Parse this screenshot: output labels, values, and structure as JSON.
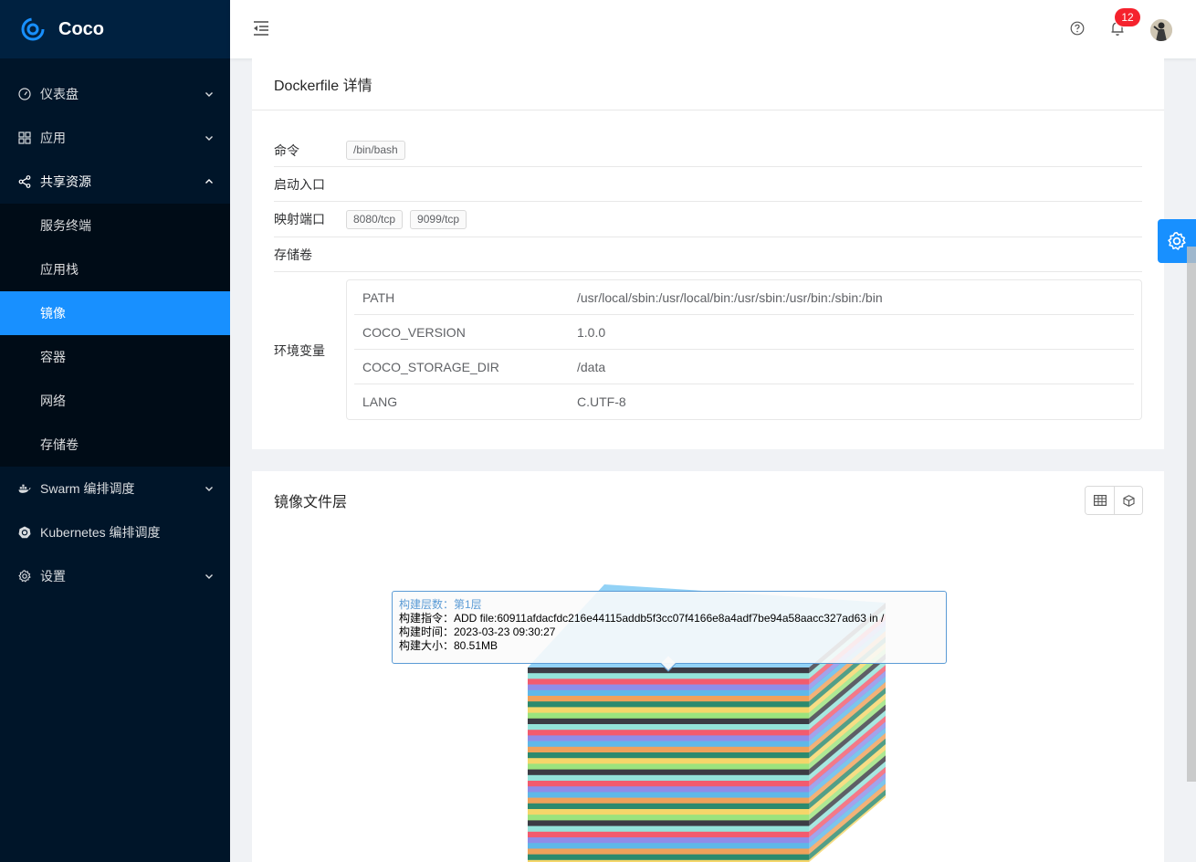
{
  "app": {
    "name": "Coco"
  },
  "sidebar": {
    "items": [
      {
        "label": "仪表盘",
        "icon": "dashboard-icon"
      },
      {
        "label": "应用",
        "icon": "apps-icon"
      },
      {
        "label": "共享资源",
        "icon": "share-icon",
        "open": true,
        "children": [
          {
            "label": "服务终端"
          },
          {
            "label": "应用栈"
          },
          {
            "label": "镜像",
            "active": true
          },
          {
            "label": "容器"
          },
          {
            "label": "网络"
          },
          {
            "label": "存储卷"
          }
        ]
      },
      {
        "label": "Swarm 编排调度",
        "icon": "docker-icon"
      },
      {
        "label": "Kubernetes 编排调度",
        "icon": "kubernetes-icon"
      },
      {
        "label": "设置",
        "icon": "gear-icon"
      }
    ]
  },
  "header": {
    "notification_count": "12"
  },
  "dockerfile": {
    "title": "Dockerfile 详情",
    "labels": {
      "cmd": "命令",
      "entrypoint": "启动入口",
      "ports": "映射端口",
      "volumes": "存储卷",
      "env": "环境变量"
    },
    "cmd": [
      "/bin/bash"
    ],
    "ports": [
      "8080/tcp",
      "9099/tcp"
    ],
    "env": [
      {
        "key": "PATH",
        "value": "/usr/local/sbin:/usr/local/bin:/usr/sbin:/usr/bin:/sbin:/bin"
      },
      {
        "key": "COCO_VERSION",
        "value": "1.0.0"
      },
      {
        "key": "COCO_STORAGE_DIR",
        "value": "/data"
      },
      {
        "key": "LANG",
        "value": "C.UTF-8"
      }
    ]
  },
  "layers": {
    "title": "镜像文件层",
    "tooltip": {
      "title": "构建层数：第1层",
      "cmd": "构建指令：ADD file:60911afdacfdc216e44115addb5f3cc07f4166e8a4adf7be94a58aacc327ad63 in /",
      "time": "构建时间：2023-03-23 09:30:27",
      "size": "构建大小：80.51MB"
    },
    "stripe_colors": [
      "#3b3b44",
      "#94e3da",
      "#f25b6e",
      "#8f8de8",
      "#5fb8e8",
      "#f0a15a",
      "#2c8a6e",
      "#f5d66a",
      "#9be37e"
    ]
  },
  "colors": {
    "primary": "#1890ff",
    "sidebar_bg": "#001529",
    "badge": "#f5222d"
  }
}
